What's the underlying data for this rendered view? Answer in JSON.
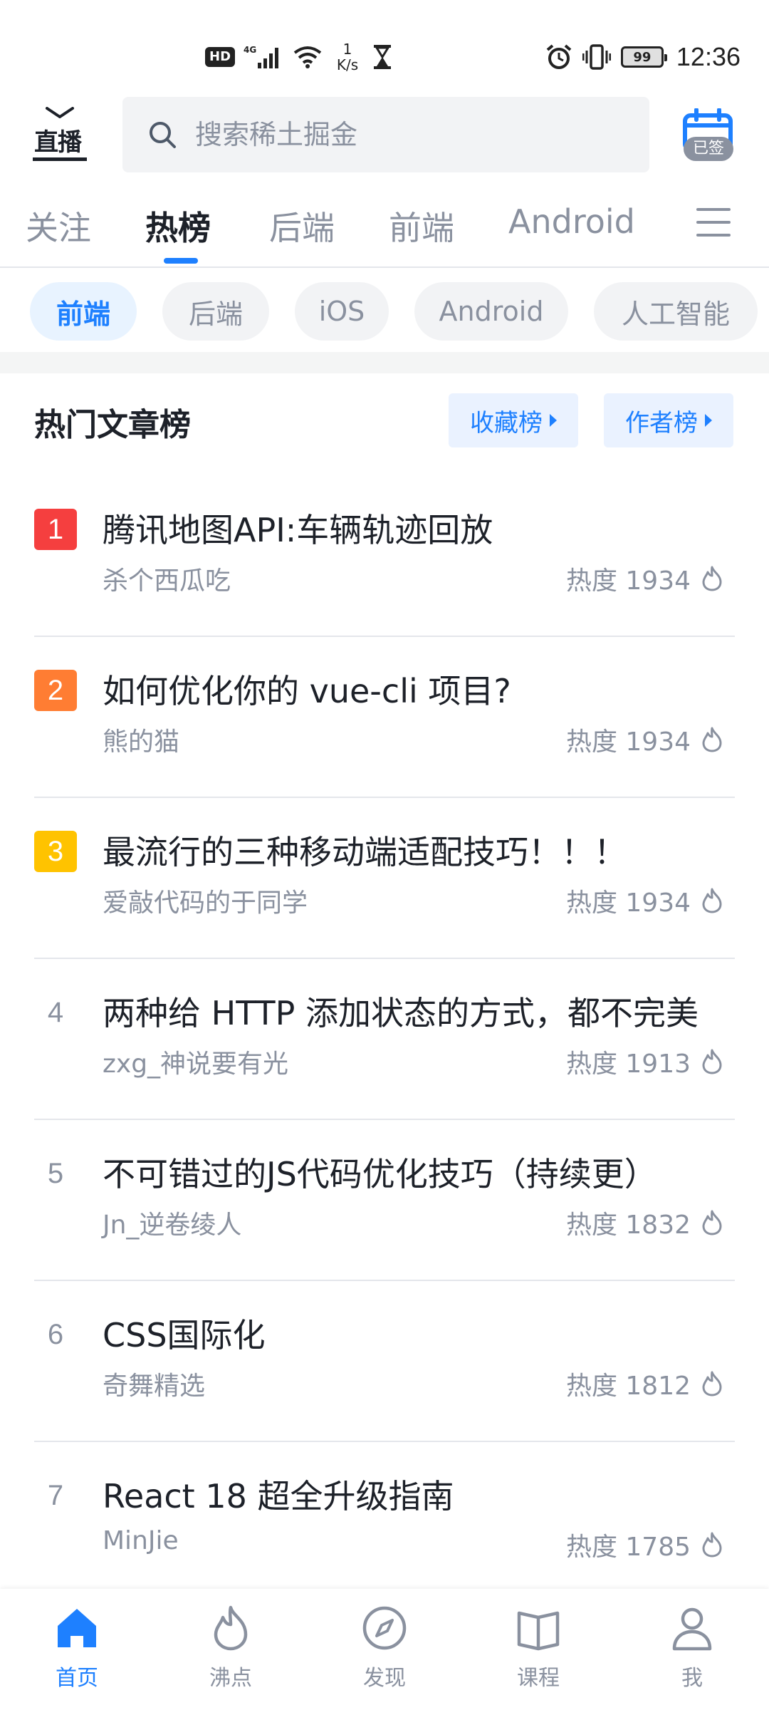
{
  "status_bar": {
    "hd": "HD",
    "net_speed_value": "1",
    "net_speed_unit": "K/s",
    "battery": "99",
    "time": "12:36"
  },
  "header": {
    "live_label": "直播",
    "search_placeholder": "搜索稀土掘金",
    "signin_badge": "已签"
  },
  "main_tabs": [
    {
      "label": "关注"
    },
    {
      "label": "热榜"
    },
    {
      "label": "后端"
    },
    {
      "label": "前端"
    },
    {
      "label": "Android"
    }
  ],
  "active_main_tab": "热榜",
  "chips": [
    {
      "label": "前端"
    },
    {
      "label": "后端"
    },
    {
      "label": "iOS"
    },
    {
      "label": "Android"
    },
    {
      "label": "人工智能"
    }
  ],
  "active_chip": "前端",
  "section": {
    "title": "热门文章榜",
    "favorites_rank_label": "收藏榜",
    "authors_rank_label": "作者榜"
  },
  "articles": [
    {
      "rank": "1",
      "title": "腾讯地图API:车辆轨迹回放",
      "author": "杀个西瓜吃",
      "heat": "热度 1934"
    },
    {
      "rank": "2",
      "title": "如何优化你的 vue-cli 项目?",
      "author": "熊的猫",
      "heat": "热度 1934"
    },
    {
      "rank": "3",
      "title": "最流行的三种移动端适配技巧！！！",
      "author": "爱敲代码的于同学",
      "heat": "热度 1934"
    },
    {
      "rank": "4",
      "title": "两种给 HTTP 添加状态的方式，都不完美",
      "author": "zxg_神说要有光",
      "heat": "热度 1913"
    },
    {
      "rank": "5",
      "title": "不可错过的JS代码优化技巧（持续更）",
      "author": "Jn_逆卷绫人",
      "heat": "热度 1832"
    },
    {
      "rank": "6",
      "title": "CSS国际化",
      "author": "奇舞精选",
      "heat": "热度 1812"
    },
    {
      "rank": "7",
      "title": "React 18 超全升级指南",
      "author": "MinJie",
      "heat": "热度 1785"
    }
  ],
  "rank_colors": {
    "1": "#f53f3f",
    "2": "#ff7d33",
    "3": "#ffc300"
  },
  "accent_color": "#1e80ff",
  "bottom_nav": [
    {
      "label": "首页",
      "icon": "home-icon"
    },
    {
      "label": "沸点",
      "icon": "flame-icon"
    },
    {
      "label": "发现",
      "icon": "compass-icon"
    },
    {
      "label": "课程",
      "icon": "book-icon"
    },
    {
      "label": "我",
      "icon": "user-icon"
    }
  ],
  "active_nav": "首页"
}
